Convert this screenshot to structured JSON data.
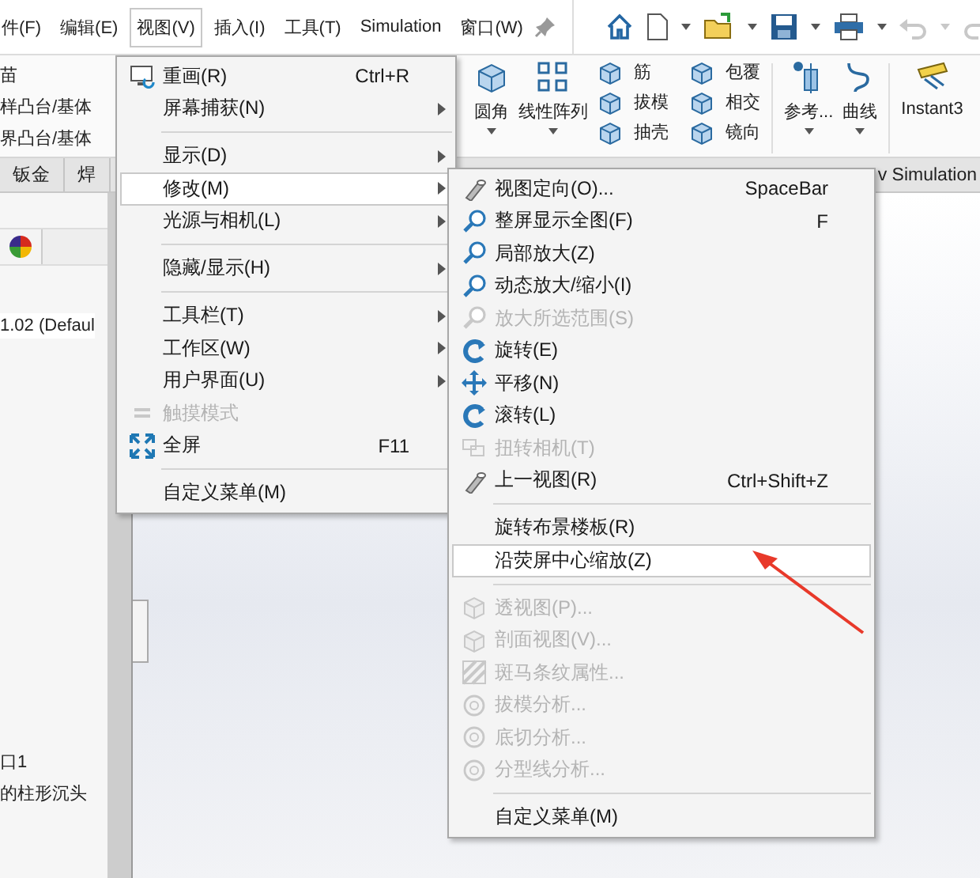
{
  "menu_bar": {
    "items": [
      {
        "label": "件(F)",
        "selected": false
      },
      {
        "label": "编辑(E)",
        "selected": false
      },
      {
        "label": "视图(V)",
        "selected": true
      },
      {
        "label": "插入(I)",
        "selected": false
      },
      {
        "label": "工具(T)",
        "selected": false
      },
      {
        "label": "Simulation",
        "selected": false
      },
      {
        "label": "窗口(W)",
        "selected": false
      }
    ]
  },
  "ribbon": {
    "cut_labels": [
      "苗",
      "样凸台/基体",
      "界凸台/基体"
    ],
    "groups": [
      {
        "kind": "large",
        "label": "圆角",
        "dropdown": true
      },
      {
        "kind": "large",
        "label": "线性阵列",
        "dropdown": true
      },
      {
        "kind": "stack",
        "items": [
          "筋",
          "拔模",
          "抽壳"
        ]
      },
      {
        "kind": "stack",
        "items": [
          "包覆",
          "相交",
          "镜向"
        ]
      },
      {
        "kind": "large",
        "label": "参考...",
        "dropdown": true
      },
      {
        "kind": "large",
        "label": "曲线",
        "dropdown": true
      },
      {
        "kind": "large",
        "label": "Instant3",
        "dropdown": false
      }
    ]
  },
  "tabs": [
    {
      "label": "钣金"
    },
    {
      "label": "焊"
    },
    {
      "label": "v Simulation"
    }
  ],
  "feature_tree": {
    "config": "1.02 (Defaul",
    "items": [
      "口1",
      "的柱形沉头"
    ]
  },
  "view_menu": {
    "items": [
      {
        "kind": "item",
        "label": "重画(R)",
        "shortcut": "Ctrl+R",
        "submenu": false,
        "disabled": false,
        "selected": false
      },
      {
        "kind": "item",
        "label": "屏幕捕获(N)",
        "submenu": true,
        "disabled": false,
        "selected": false
      },
      {
        "kind": "separator"
      },
      {
        "kind": "item",
        "label": "显示(D)",
        "submenu": true,
        "disabled": false,
        "selected": false
      },
      {
        "kind": "item",
        "label": "修改(M)",
        "submenu": true,
        "disabled": false,
        "selected": true
      },
      {
        "kind": "item",
        "label": "光源与相机(L)",
        "submenu": true,
        "disabled": false,
        "selected": false
      },
      {
        "kind": "separator"
      },
      {
        "kind": "item",
        "label": "隐藏/显示(H)",
        "submenu": true,
        "disabled": false,
        "selected": false
      },
      {
        "kind": "separator"
      },
      {
        "kind": "item",
        "label": "工具栏(T)",
        "submenu": true,
        "disabled": false,
        "selected": false
      },
      {
        "kind": "item",
        "label": "工作区(W)",
        "submenu": true,
        "disabled": false,
        "selected": false
      },
      {
        "kind": "item",
        "label": "用户界面(U)",
        "submenu": true,
        "disabled": false,
        "selected": false
      },
      {
        "kind": "item",
        "label": "触摸模式",
        "submenu": false,
        "disabled": true,
        "selected": false
      },
      {
        "kind": "item",
        "label": "全屏",
        "shortcut": "F11",
        "submenu": false,
        "disabled": false,
        "selected": false
      },
      {
        "kind": "separator"
      },
      {
        "kind": "item",
        "label": "自定义菜单(M)",
        "submenu": false,
        "disabled": false,
        "selected": false
      }
    ]
  },
  "modify_submenu": {
    "items": [
      {
        "kind": "item",
        "label": "视图定向(O)...",
        "shortcut": "SpaceBar",
        "submenu": false,
        "disabled": false,
        "selected": false
      },
      {
        "kind": "item",
        "label": "整屏显示全图(F)",
        "shortcut": "F",
        "submenu": false,
        "disabled": false,
        "selected": false
      },
      {
        "kind": "item",
        "label": "局部放大(Z)",
        "submenu": false,
        "disabled": false,
        "selected": false
      },
      {
        "kind": "item",
        "label": "动态放大/缩小(I)",
        "submenu": false,
        "disabled": false,
        "selected": false
      },
      {
        "kind": "item",
        "label": "放大所选范围(S)",
        "submenu": false,
        "disabled": true,
        "selected": false
      },
      {
        "kind": "item",
        "label": "旋转(E)",
        "submenu": false,
        "disabled": false,
        "selected": false
      },
      {
        "kind": "item",
        "label": "平移(N)",
        "submenu": false,
        "disabled": false,
        "selected": false
      },
      {
        "kind": "item",
        "label": "滚转(L)",
        "submenu": false,
        "disabled": false,
        "selected": false
      },
      {
        "kind": "item",
        "label": "扭转相机(T)",
        "submenu": false,
        "disabled": true,
        "selected": false
      },
      {
        "kind": "item",
        "label": "上一视图(R)",
        "shortcut": "Ctrl+Shift+Z",
        "submenu": false,
        "disabled": false,
        "selected": false
      },
      {
        "kind": "separator"
      },
      {
        "kind": "item",
        "label": "旋转布景楼板(R)",
        "submenu": false,
        "disabled": false,
        "selected": false
      },
      {
        "kind": "item",
        "label": "沿荧屏中心缩放(Z)",
        "submenu": false,
        "disabled": false,
        "selected": true
      },
      {
        "kind": "separator"
      },
      {
        "kind": "item",
        "label": "透视图(P)...",
        "submenu": false,
        "disabled": true,
        "selected": false
      },
      {
        "kind": "item",
        "label": "剖面视图(V)...",
        "submenu": false,
        "disabled": true,
        "selected": false
      },
      {
        "kind": "item",
        "label": "斑马条纹属性...",
        "submenu": false,
        "disabled": true,
        "selected": false
      },
      {
        "kind": "item",
        "label": "拔模分析...",
        "submenu": false,
        "disabled": true,
        "selected": false
      },
      {
        "kind": "item",
        "label": "底切分析...",
        "submenu": false,
        "disabled": true,
        "selected": false
      },
      {
        "kind": "item",
        "label": "分型线分析...",
        "submenu": false,
        "disabled": true,
        "selected": false
      },
      {
        "kind": "separator"
      },
      {
        "kind": "item",
        "label": "自定义菜单(M)",
        "submenu": false,
        "disabled": false,
        "selected": false
      }
    ]
  }
}
